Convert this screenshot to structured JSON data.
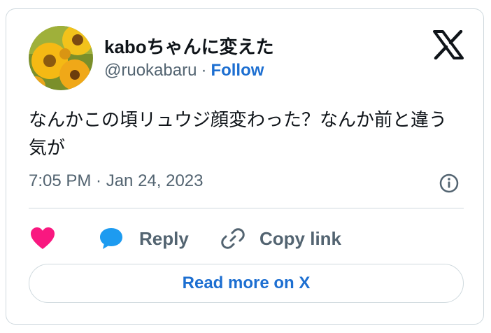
{
  "tweet": {
    "author_name": "kaboちゃんに変えた",
    "handle": "@ruokabaru",
    "separator": "·",
    "follow_label": "Follow",
    "text": "なんかこの頃リュウジ顔変わった？なんか前と違う気が",
    "timestamp": "7:05 PM · Jan 24, 2023"
  },
  "actions": {
    "reply_label": "Reply",
    "copy_link_label": "Copy link"
  },
  "footer": {
    "read_more_label": "Read more on X"
  },
  "icons": {
    "avatar": "sunflower-avatar",
    "logo": "x-logo-icon",
    "info": "info-icon",
    "like": "heart-icon",
    "reply": "speech-bubble-icon",
    "copy_link": "link-icon"
  },
  "colors": {
    "link_blue": "#1d6fd1",
    "heart": "#f91880",
    "reply_bubble": "#1d9bf0",
    "secondary_text": "#536471",
    "border": "#cfd9de"
  }
}
